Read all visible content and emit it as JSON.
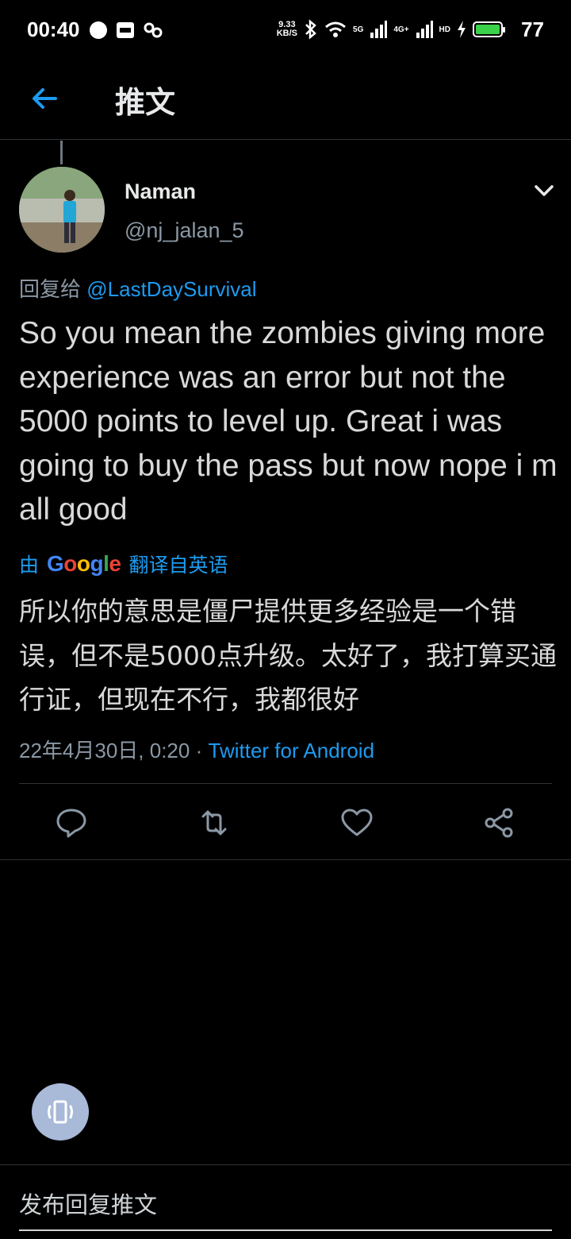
{
  "status_bar": {
    "time": "00:40",
    "speed_value": "9.33",
    "speed_unit": "KB/S",
    "net1": "5G",
    "net2": "4G+",
    "hd": "HD",
    "battery": "77",
    "battery_color": "#3bd14a"
  },
  "header": {
    "title": "推文"
  },
  "tweet": {
    "name": "Naman",
    "handle": "@nj_jalan_5",
    "reply_prefix": "回复给",
    "reply_mention": "@LastDaySurvival",
    "text": "So you mean the zombies giving more experience was an error but not the 5000 points to level up. Great i was going to buy the pass but now nope i m all good",
    "translate_prefix": "由",
    "translate_brand": "Google",
    "translate_suffix": "翻译自英语",
    "translated_text": "所以你的意思是僵尸提供更多经验是一个错误，但不是5000点升级。太好了，我打算买通行证，但现在不行，我都很好",
    "timestamp": "22年4月30日, 0:20",
    "separator": "·",
    "source": "Twitter for Android"
  },
  "compose": {
    "placeholder": "发布回复推文"
  },
  "colors": {
    "accent": "#1d9bf0",
    "muted": "#8b98a5",
    "background": "#000000"
  }
}
